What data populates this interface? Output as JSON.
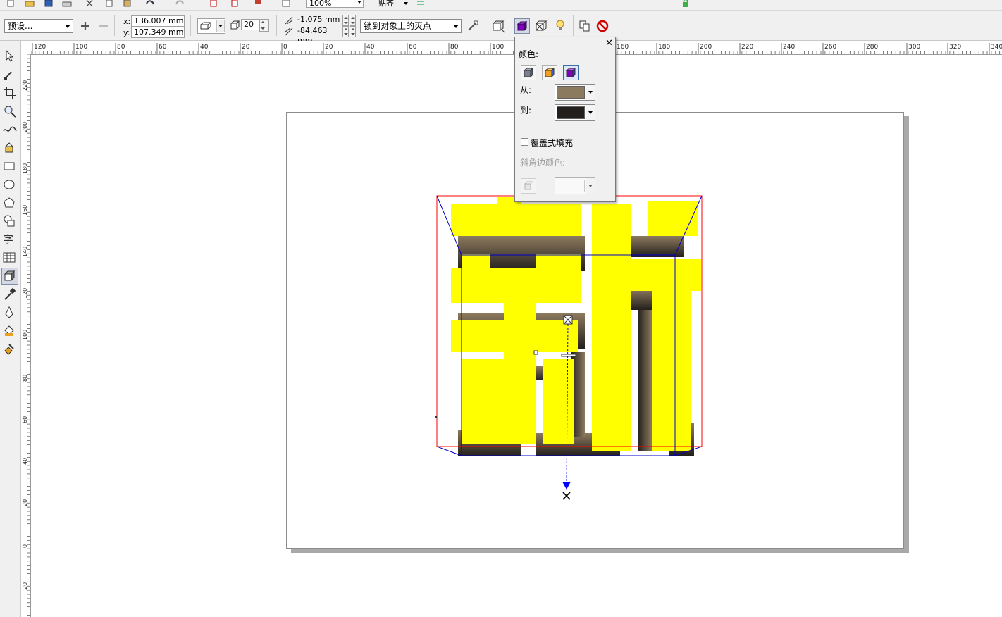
{
  "standard_toolbar": {
    "zoom_level": "100%",
    "snap_label": "贴齐"
  },
  "property_bar": {
    "preset_value": "预设...",
    "x_label": "x:",
    "x_value": "136.007 mm",
    "y_label": "y:",
    "y_value": "107.349 mm",
    "depth_value": "20",
    "vp_x_value": "-1.075 mm",
    "vp_y_value": "-84.463 mm",
    "vanishing_point_lock": "锁到对象上的灭点"
  },
  "rulers": {
    "horizontal_ticks": [
      "120",
      "100",
      "80",
      "60",
      "40",
      "20",
      "0",
      "20",
      "40",
      "60",
      "80",
      "100",
      "160",
      "180",
      "200",
      "220",
      "240",
      "260",
      "280",
      "300",
      "320",
      "340"
    ],
    "vertical_ticks": [
      "220",
      "200",
      "180",
      "160",
      "140",
      "120",
      "100",
      "80",
      "60",
      "40",
      "20",
      "0",
      "20"
    ]
  },
  "color_popup": {
    "title": "颜色:",
    "from_label": "从:",
    "to_label": "到:",
    "from_color": "#8c7a5e",
    "to_color": "#231f1c",
    "overprint_label": "覆盖式填充",
    "bevel_color_label": "斜角边颜色:",
    "bevel_color": "#ffffff"
  },
  "artwork": {
    "glyph": "新",
    "face_color": "#ffff00"
  },
  "colors": {
    "selection_box": "#ff0000",
    "extrude_wire": "#0000c8",
    "vanishing_point": "#0000ff"
  }
}
